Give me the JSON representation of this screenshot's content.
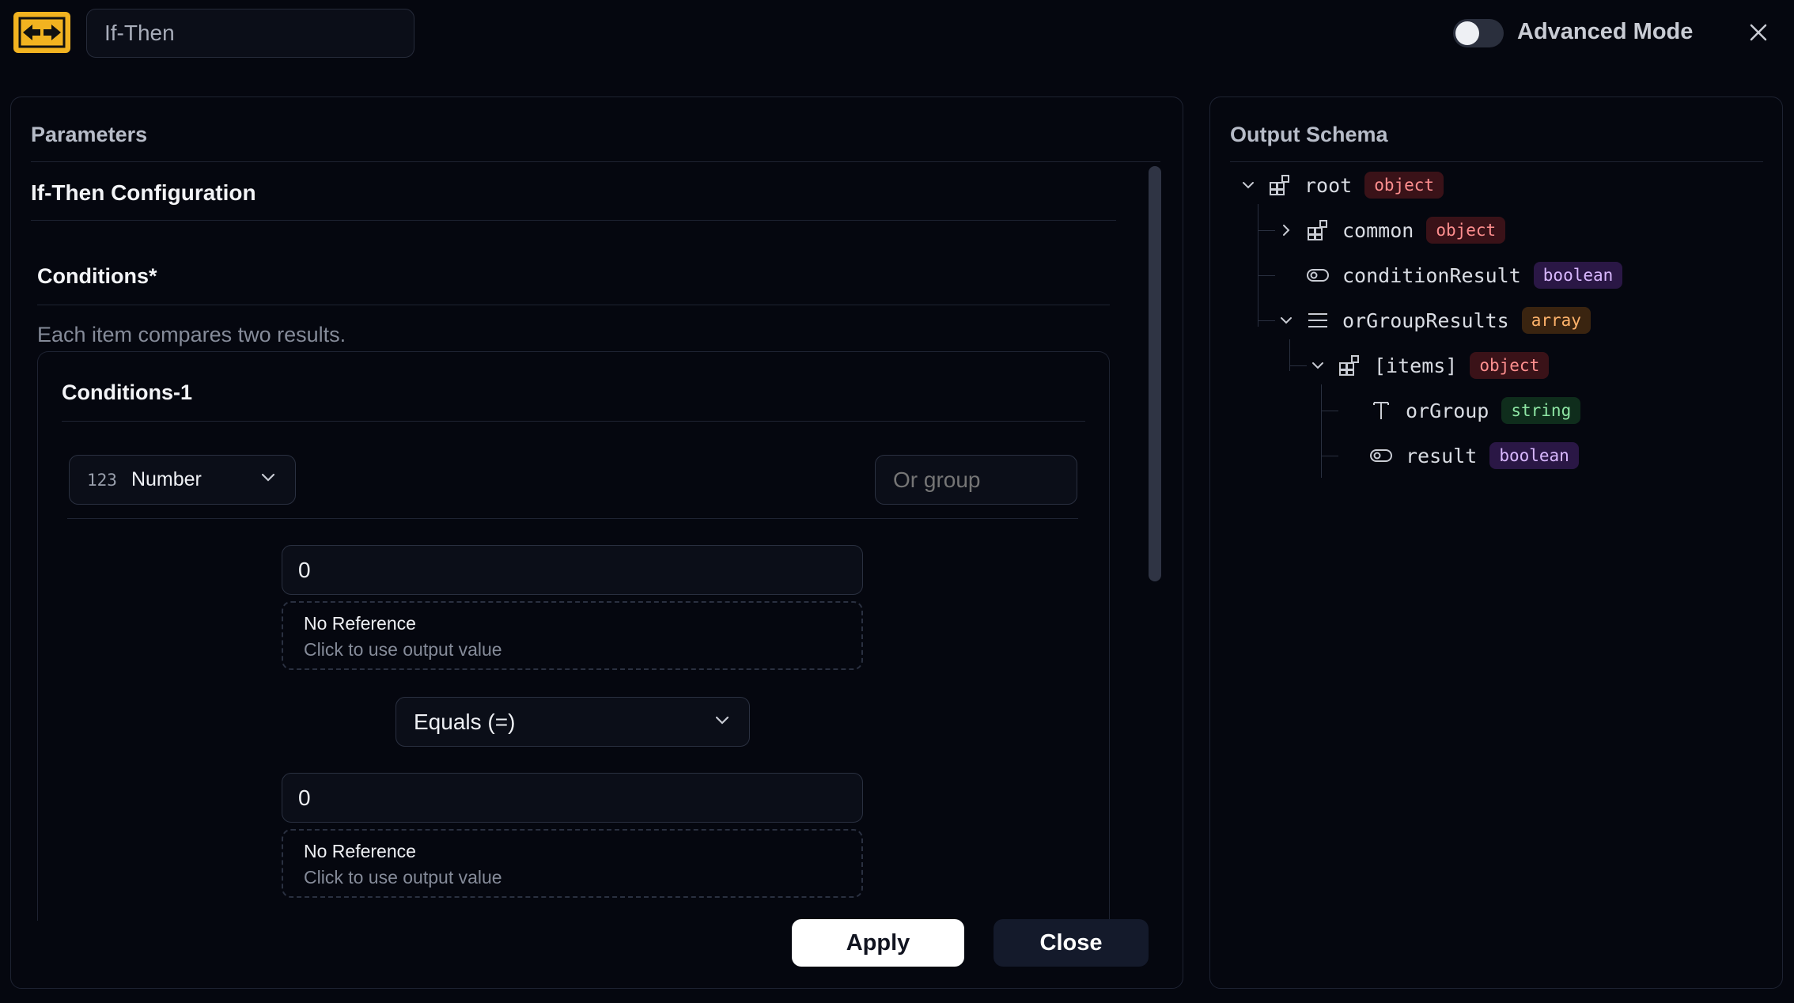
{
  "header": {
    "node_name": "If-Then",
    "advanced_mode_label": "Advanced Mode",
    "advanced_mode_on": false
  },
  "parameters": {
    "title": "Parameters",
    "config_title": "If-Then Configuration",
    "conditions_label": "Conditions*",
    "conditions_help": "Each item compares two results.",
    "item_title": "Conditions-1",
    "type_icon": "123",
    "type_value": "Number",
    "or_group_placeholder": "Or group",
    "left_value": "0",
    "left_ref_title": "No Reference",
    "left_ref_hint": "Click to use output value",
    "operator": "Equals (=)",
    "right_value": "0",
    "right_ref_title": "No Reference",
    "right_ref_hint": "Click to use output value"
  },
  "footer": {
    "apply_label": "Apply",
    "close_label": "Close"
  },
  "output_schema": {
    "title": "Output Schema",
    "nodes": [
      {
        "name": "root",
        "type": "object",
        "icon": "object-icon",
        "expanded": true
      },
      {
        "name": "common",
        "type": "object",
        "icon": "object-icon",
        "expanded": false
      },
      {
        "name": "conditionResult",
        "type": "boolean",
        "icon": "boolean-icon"
      },
      {
        "name": "orGroupResults",
        "type": "array",
        "icon": "array-icon",
        "expanded": true
      },
      {
        "name": "[items]",
        "type": "object",
        "icon": "object-icon",
        "expanded": true
      },
      {
        "name": "orGroup",
        "type": "string",
        "icon": "string-icon"
      },
      {
        "name": "result",
        "type": "boolean",
        "icon": "boolean-icon"
      }
    ]
  },
  "colors": {
    "background": "#05070f",
    "accent": "#f2b320",
    "object_badge": "#ff8f8f",
    "boolean_badge": "#d9b8ff",
    "array_badge": "#ffb36b",
    "string_badge": "#8ee6a4"
  }
}
